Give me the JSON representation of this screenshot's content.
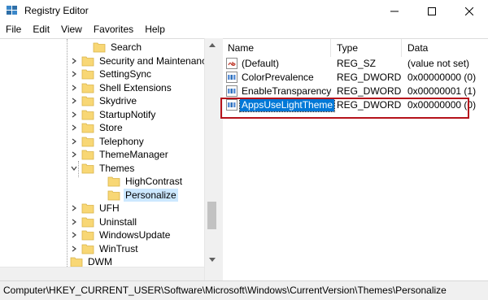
{
  "window": {
    "title": "Registry Editor"
  },
  "menu": [
    "File",
    "Edit",
    "View",
    "Favorites",
    "Help"
  ],
  "tree": {
    "items": [
      {
        "label": "Search",
        "expander": "none"
      },
      {
        "label": "Security and Maintenance",
        "expander": "collapsed"
      },
      {
        "label": "SettingSync",
        "expander": "collapsed"
      },
      {
        "label": "Shell Extensions",
        "expander": "collapsed"
      },
      {
        "label": "Skydrive",
        "expander": "collapsed"
      },
      {
        "label": "StartupNotify",
        "expander": "collapsed"
      },
      {
        "label": "Store",
        "expander": "collapsed"
      },
      {
        "label": "Telephony",
        "expander": "collapsed"
      },
      {
        "label": "ThemeManager",
        "expander": "collapsed"
      },
      {
        "label": "Themes",
        "expander": "expanded"
      },
      {
        "label": "HighContrast",
        "expander": "none"
      },
      {
        "label": "Personalize",
        "expander": "none",
        "selected": true
      },
      {
        "label": "UFH",
        "expander": "collapsed"
      },
      {
        "label": "Uninstall",
        "expander": "collapsed"
      },
      {
        "label": "WindowsUpdate",
        "expander": "collapsed"
      },
      {
        "label": "WinTrust",
        "expander": "collapsed"
      },
      {
        "label": "DWM",
        "expander": "none"
      }
    ]
  },
  "list": {
    "columns": {
      "name": "Name",
      "type": "Type",
      "data": "Data"
    },
    "rows": [
      {
        "name": "(Default)",
        "type": "REG_SZ",
        "data": "(value not set)",
        "icon": "string-value-icon"
      },
      {
        "name": "ColorPrevalence",
        "type": "REG_DWORD",
        "data": "0x00000000 (0)",
        "icon": "dword-value-icon"
      },
      {
        "name": "EnableTransparency",
        "type": "REG_DWORD",
        "data": "0x00000001 (1)",
        "icon": "dword-value-icon"
      },
      {
        "name": "AppsUseLightTheme",
        "type": "REG_DWORD",
        "data": "0x00000000 (0)",
        "icon": "dword-value-icon",
        "selected": true
      }
    ]
  },
  "status": {
    "path": "Computer\\HKEY_CURRENT_USER\\Software\\Microsoft\\Windows\\CurrentVersion\\Themes\\Personalize"
  },
  "colors": {
    "selection": "#0078d7",
    "highlight_box": "#b5121b",
    "folder": "#f8d775",
    "tree_selected": "#cce8ff"
  }
}
